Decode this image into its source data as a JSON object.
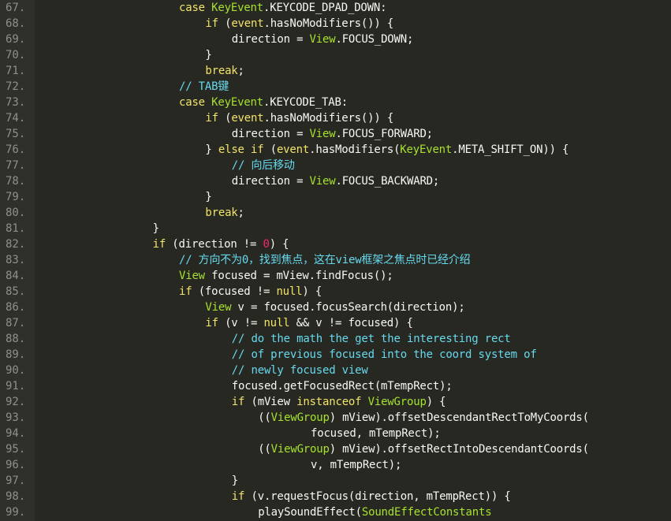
{
  "editor": {
    "lines": [
      {
        "n": "67.",
        "indent": 5,
        "tokens": [
          {
            "t": "kw",
            "s": "case "
          },
          {
            "t": "cls",
            "s": "KeyEvent"
          },
          {
            "t": "plain",
            "s": ".KEYCODE_DPAD_DOWN:"
          }
        ]
      },
      {
        "n": "68.",
        "indent": 6,
        "tokens": [
          {
            "t": "kw",
            "s": "if "
          },
          {
            "t": "plain",
            "s": "("
          },
          {
            "t": "kw",
            "s": "event"
          },
          {
            "t": "plain",
            "s": ".hasNoModifiers()) {"
          }
        ]
      },
      {
        "n": "69.",
        "indent": 7,
        "tokens": [
          {
            "t": "plain",
            "s": "direction = "
          },
          {
            "t": "cls",
            "s": "View"
          },
          {
            "t": "plain",
            "s": ".FOCUS_DOWN;"
          }
        ]
      },
      {
        "n": "70.",
        "indent": 6,
        "tokens": [
          {
            "t": "plain",
            "s": "}"
          }
        ]
      },
      {
        "n": "71.",
        "indent": 6,
        "tokens": [
          {
            "t": "kw",
            "s": "break"
          },
          {
            "t": "plain",
            "s": ";"
          }
        ]
      },
      {
        "n": "72.",
        "indent": 5,
        "tokens": [
          {
            "t": "cmt",
            "s": "// TAB键"
          }
        ]
      },
      {
        "n": "73.",
        "indent": 5,
        "tokens": [
          {
            "t": "kw",
            "s": "case "
          },
          {
            "t": "cls",
            "s": "KeyEvent"
          },
          {
            "t": "plain",
            "s": ".KEYCODE_TAB:"
          }
        ]
      },
      {
        "n": "74.",
        "indent": 6,
        "tokens": [
          {
            "t": "kw",
            "s": "if "
          },
          {
            "t": "plain",
            "s": "("
          },
          {
            "t": "kw",
            "s": "event"
          },
          {
            "t": "plain",
            "s": ".hasNoModifiers()) {"
          }
        ]
      },
      {
        "n": "75.",
        "indent": 7,
        "tokens": [
          {
            "t": "plain",
            "s": "direction = "
          },
          {
            "t": "cls",
            "s": "View"
          },
          {
            "t": "plain",
            "s": ".FOCUS_FORWARD;"
          }
        ]
      },
      {
        "n": "76.",
        "indent": 6,
        "tokens": [
          {
            "t": "plain",
            "s": "} "
          },
          {
            "t": "kw",
            "s": "else if "
          },
          {
            "t": "plain",
            "s": "("
          },
          {
            "t": "kw",
            "s": "event"
          },
          {
            "t": "plain",
            "s": ".hasModifiers("
          },
          {
            "t": "cls",
            "s": "KeyEvent"
          },
          {
            "t": "plain",
            "s": ".META_SHIFT_ON)) {"
          }
        ]
      },
      {
        "n": "77.",
        "indent": 7,
        "tokens": [
          {
            "t": "cmt",
            "s": "// 向后移动"
          }
        ]
      },
      {
        "n": "78.",
        "indent": 7,
        "tokens": [
          {
            "t": "plain",
            "s": "direction = "
          },
          {
            "t": "cls",
            "s": "View"
          },
          {
            "t": "plain",
            "s": ".FOCUS_BACKWARD;"
          }
        ]
      },
      {
        "n": "79.",
        "indent": 6,
        "tokens": [
          {
            "t": "plain",
            "s": "}"
          }
        ]
      },
      {
        "n": "80.",
        "indent": 6,
        "tokens": [
          {
            "t": "kw",
            "s": "break"
          },
          {
            "t": "plain",
            "s": ";"
          }
        ]
      },
      {
        "n": "81.",
        "indent": 4,
        "tokens": [
          {
            "t": "plain",
            "s": "}"
          }
        ]
      },
      {
        "n": "82.",
        "indent": 4,
        "tokens": [
          {
            "t": "kw",
            "s": "if "
          },
          {
            "t": "plain",
            "s": "(direction != "
          },
          {
            "t": "num",
            "s": "0"
          },
          {
            "t": "plain",
            "s": ") {"
          }
        ]
      },
      {
        "n": "83.",
        "indent": 5,
        "tokens": [
          {
            "t": "cmt",
            "s": "// 方向不为0，找到焦点，这在view框架之焦点时已经介绍"
          }
        ]
      },
      {
        "n": "84.",
        "indent": 5,
        "tokens": [
          {
            "t": "cls",
            "s": "View "
          },
          {
            "t": "plain",
            "s": "focused = mView.findFocus();"
          }
        ]
      },
      {
        "n": "85.",
        "indent": 5,
        "tokens": [
          {
            "t": "kw",
            "s": "if "
          },
          {
            "t": "plain",
            "s": "(focused != "
          },
          {
            "t": "kw",
            "s": "null"
          },
          {
            "t": "plain",
            "s": ") {"
          }
        ]
      },
      {
        "n": "86.",
        "indent": 6,
        "tokens": [
          {
            "t": "cls",
            "s": "View "
          },
          {
            "t": "plain",
            "s": "v = focused.focusSearch(direction);"
          }
        ]
      },
      {
        "n": "87.",
        "indent": 6,
        "tokens": [
          {
            "t": "kw",
            "s": "if "
          },
          {
            "t": "plain",
            "s": "(v != "
          },
          {
            "t": "kw",
            "s": "null "
          },
          {
            "t": "plain",
            "s": "&& v != focused) {"
          }
        ]
      },
      {
        "n": "88.",
        "indent": 7,
        "tokens": [
          {
            "t": "cmt",
            "s": "// do the math the get the interesting rect"
          }
        ]
      },
      {
        "n": "89.",
        "indent": 7,
        "tokens": [
          {
            "t": "cmt",
            "s": "// of previous focused into the coord system of"
          }
        ]
      },
      {
        "n": "90.",
        "indent": 7,
        "tokens": [
          {
            "t": "cmt",
            "s": "// newly focused view"
          }
        ]
      },
      {
        "n": "91.",
        "indent": 7,
        "tokens": [
          {
            "t": "plain",
            "s": "focused.getFocusedRect(mTempRect);"
          }
        ]
      },
      {
        "n": "92.",
        "indent": 7,
        "tokens": [
          {
            "t": "kw",
            "s": "if "
          },
          {
            "t": "plain",
            "s": "(mView "
          },
          {
            "t": "kw",
            "s": "instanceof "
          },
          {
            "t": "cls",
            "s": "ViewGroup"
          },
          {
            "t": "plain",
            "s": ") {"
          }
        ]
      },
      {
        "n": "93.",
        "indent": 8,
        "tokens": [
          {
            "t": "plain",
            "s": "(("
          },
          {
            "t": "cls",
            "s": "ViewGroup"
          },
          {
            "t": "plain",
            "s": ") mView).offsetDescendantRectToMyCoords("
          }
        ]
      },
      {
        "n": "94.",
        "indent": 10,
        "tokens": [
          {
            "t": "plain",
            "s": "focused, mTempRect);"
          }
        ]
      },
      {
        "n": "95.",
        "indent": 8,
        "tokens": [
          {
            "t": "plain",
            "s": "(("
          },
          {
            "t": "cls",
            "s": "ViewGroup"
          },
          {
            "t": "plain",
            "s": ") mView).offsetRectIntoDescendantCoords("
          }
        ]
      },
      {
        "n": "96.",
        "indent": 10,
        "tokens": [
          {
            "t": "plain",
            "s": "v, mTempRect);"
          }
        ]
      },
      {
        "n": "97.",
        "indent": 7,
        "tokens": [
          {
            "t": "plain",
            "s": "}"
          }
        ]
      },
      {
        "n": "98.",
        "indent": 7,
        "tokens": [
          {
            "t": "kw",
            "s": "if "
          },
          {
            "t": "plain",
            "s": "(v.requestFocus(direction, mTempRect)) {"
          }
        ]
      },
      {
        "n": "99.",
        "indent": 8,
        "tokens": [
          {
            "t": "plain",
            "s": "playSoundEffect("
          },
          {
            "t": "cls",
            "s": "SoundEffectConstants"
          }
        ]
      }
    ]
  },
  "colors": {
    "background": "#272822",
    "gutter": "#2f3029",
    "line_number": "#8f908a",
    "keyword": "#f2e36a",
    "class_name": "#a6e22e",
    "comment": "#66d9ef",
    "number": "#f92672",
    "plain": "#f8f8f2"
  }
}
